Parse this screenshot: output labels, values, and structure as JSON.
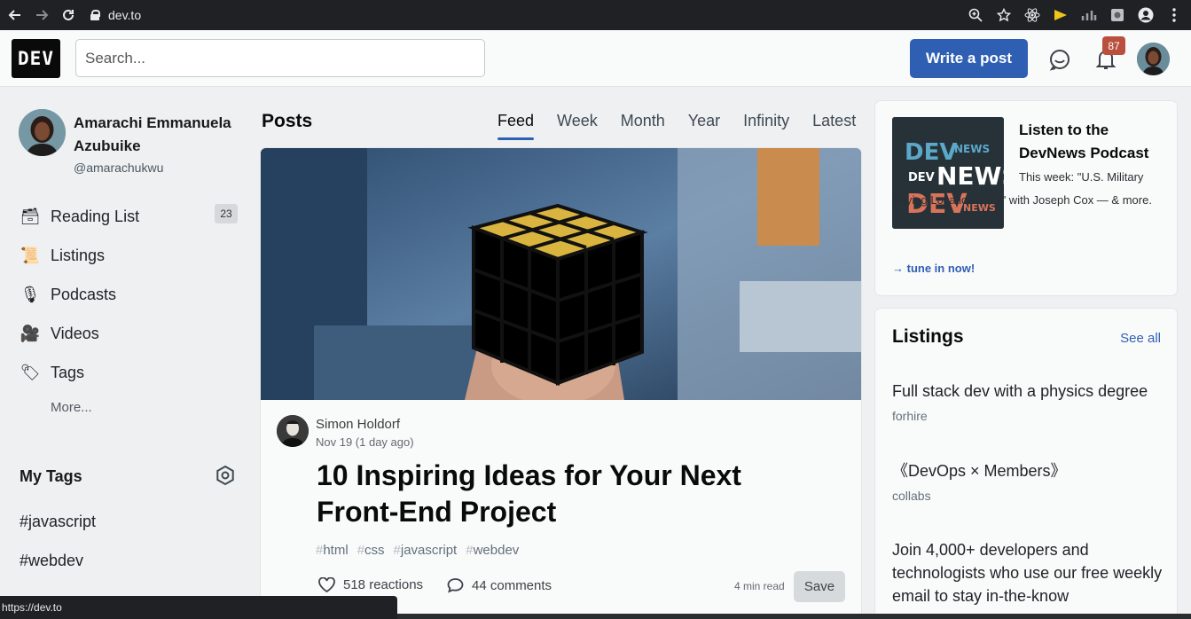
{
  "browser": {
    "url": "dev.to",
    "status_url": "https://dev.to"
  },
  "header": {
    "logo_text": "DEV",
    "search_placeholder": "Search...",
    "write_post_label": "Write a post",
    "notification_count": "87"
  },
  "sidebar": {
    "profile": {
      "name": "Amarachi Emmanuela Azubuike",
      "handle": "@amarachukwu"
    },
    "nav_items": [
      {
        "icon": "reading-list-icon",
        "emoji": "🗃",
        "label": "Reading List",
        "count": "23"
      },
      {
        "icon": "listings-icon",
        "emoji": "📜",
        "label": "Listings",
        "count": ""
      },
      {
        "icon": "podcasts-icon",
        "emoji": "🎙",
        "label": "Podcasts",
        "count": ""
      },
      {
        "icon": "videos-icon",
        "emoji": "🎥",
        "label": "Videos",
        "count": ""
      },
      {
        "icon": "tags-icon",
        "emoji": "🏷",
        "label": "Tags",
        "count": ""
      }
    ],
    "more_label": "More...",
    "my_tags_title": "My Tags",
    "tags": [
      "#javascript",
      "#webdev"
    ]
  },
  "main": {
    "posts_title": "Posts",
    "tabs": [
      {
        "label": "Feed",
        "active": true
      },
      {
        "label": "Week",
        "active": false
      },
      {
        "label": "Month",
        "active": false
      },
      {
        "label": "Year",
        "active": false
      },
      {
        "label": "Infinity",
        "active": false
      },
      {
        "label": "Latest",
        "active": false
      }
    ],
    "post": {
      "author": "Simon Holdorf",
      "date": "Nov 19 (1 day ago)",
      "title": "10 Inspiring Ideas for Your Next Front-End Project",
      "tags": [
        "html",
        "css",
        "javascript",
        "webdev"
      ],
      "reactions": "518 reactions",
      "comments": "44 comments",
      "read_time": "4 min read",
      "save_label": "Save"
    }
  },
  "right": {
    "podcast": {
      "title": "Listen to the DevNews Podcast",
      "description": "This week: \"U.S. Military Buying Location Data\" with Joseph Cox — & more.",
      "cta": "→ tune in now!"
    },
    "listings": {
      "title": "Listings",
      "see_all": "See all",
      "items": [
        {
          "title": "Full stack dev with a physics degree",
          "category": "forhire"
        },
        {
          "title": "《DevOps × Members》",
          "category": "collabs"
        },
        {
          "title": "Join 4,000+ developers and technologists who use our free weekly email to stay in-the-know",
          "category": ""
        }
      ]
    }
  },
  "colors": {
    "accent": "#2f5fb3",
    "badge": "#b94f3d",
    "background": "#eef0f1",
    "card": "#f9fafa"
  }
}
